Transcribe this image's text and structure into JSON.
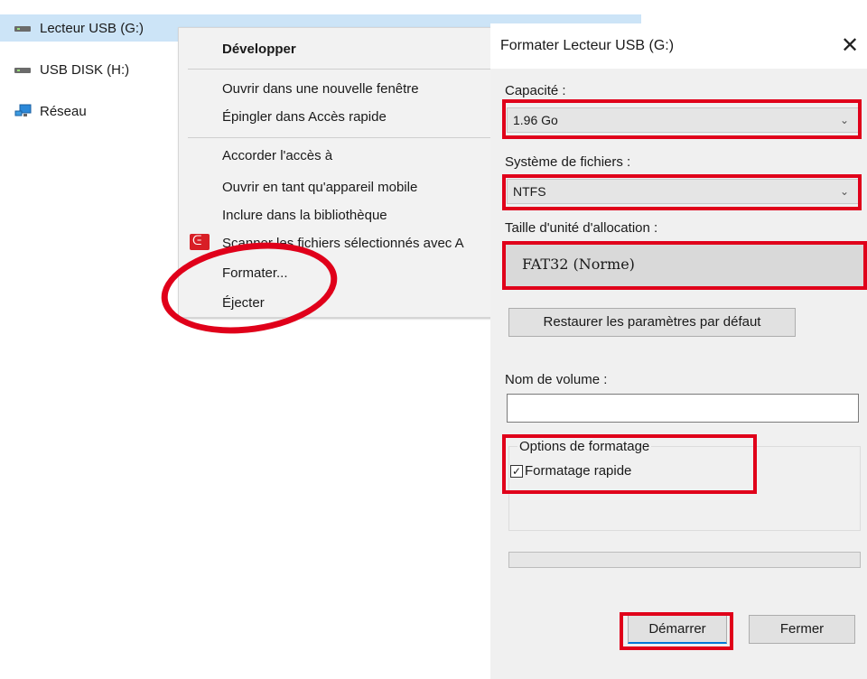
{
  "nav": {
    "items": [
      {
        "label": "Lecteur USB (G:)",
        "icon": "usb-drive-icon",
        "selected": true
      },
      {
        "label": "USB DISK (H:)",
        "icon": "usb-drive-icon",
        "selected": false
      },
      {
        "label": "Réseau",
        "icon": "network-icon",
        "selected": false
      }
    ]
  },
  "context_menu": {
    "items": [
      {
        "label": "Développer"
      },
      {
        "label": "Ouvrir dans une nouvelle fenêtre"
      },
      {
        "label": "Épingler dans Accès rapide"
      },
      {
        "label": "Accorder l'accès à"
      },
      {
        "label": "Ouvrir en tant qu'appareil mobile"
      },
      {
        "label": "Inclure dans la bibliothèque"
      },
      {
        "label": "Scanner les fichiers sélectionnés avec A"
      },
      {
        "label": "Formater..."
      },
      {
        "label": "Éjecter"
      }
    ]
  },
  "dialog": {
    "title": "Formater Lecteur USB (G:)",
    "close_glyph": "✕",
    "capacity_label": "Capacité :",
    "capacity_value": "1.96 Go",
    "fs_label": "Système de fichiers :",
    "fs_value": "NTFS",
    "alloc_label": "Taille d'unité d'allocation :",
    "alloc_value": "FAT32 (Norme)",
    "restore_button": "Restaurer les paramètres par défaut",
    "volume_label": "Nom de volume :",
    "volume_value": "",
    "options_label": "Options de formatage",
    "quick_format_label": "Formatage rapide",
    "quick_format_checked": true,
    "check_glyph": "✓",
    "start_button": "Démarrer",
    "close_button": "Fermer"
  },
  "colors": {
    "highlight": "#e0001a",
    "selection": "#cce4f7"
  }
}
